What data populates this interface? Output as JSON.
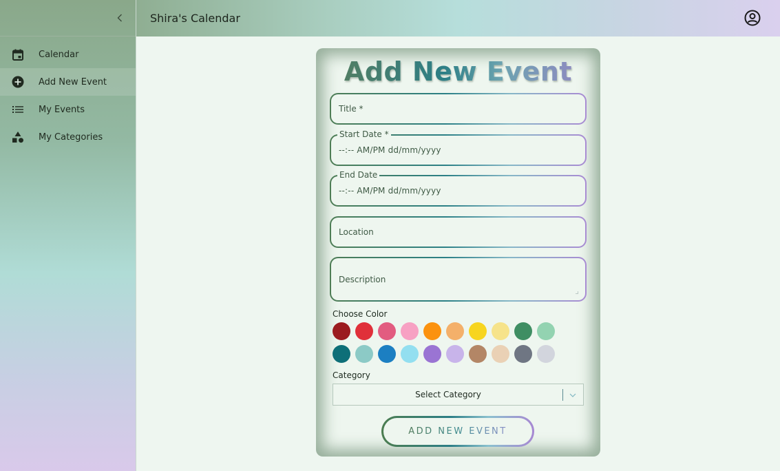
{
  "header": {
    "title": "Shira's Calendar",
    "account_icon": "account-circle-icon"
  },
  "sidebar": {
    "collapse_icon": "chevron-left-icon",
    "items": [
      {
        "label": "Calendar",
        "icon": "calendar-icon",
        "active": false
      },
      {
        "label": "Add New Event",
        "icon": "add-circle-icon",
        "active": true
      },
      {
        "label": "My Events",
        "icon": "list-icon",
        "active": false
      },
      {
        "label": "My Categories",
        "icon": "category-shapes-icon",
        "active": false
      }
    ]
  },
  "form": {
    "heading": "Add New Event",
    "title_field": {
      "label": "Title *",
      "value": ""
    },
    "start_date": {
      "label": "Start Date *",
      "value": "--:-- AM/PM  dd/mm/yyyy"
    },
    "end_date": {
      "label": "End Date",
      "value": "--:-- AM/PM  dd/mm/yyyy"
    },
    "location": {
      "label": "Location",
      "value": ""
    },
    "description": {
      "label": "Description",
      "value": ""
    },
    "color_label": "Choose Color",
    "colors_row1": [
      "#9b1b1f",
      "#e0303a",
      "#e25c80",
      "#f7a1c3",
      "#fb920f",
      "#f4b06a",
      "#f7d51f",
      "#f6e38a",
      "#3f8e63",
      "#93d3b1"
    ],
    "colors_row2": [
      "#0e6f78",
      "#8ccac6",
      "#1c7fc2",
      "#93dff0",
      "#9a74d3",
      "#c8b4ea",
      "#b38666",
      "#ead1b5",
      "#6f7683",
      "#d2d5dd"
    ],
    "category_label": "Category",
    "category_select": {
      "value": "Select Category",
      "icon": "chevron-down-icon"
    },
    "submit_label": "ADD NEW EVENT"
  }
}
